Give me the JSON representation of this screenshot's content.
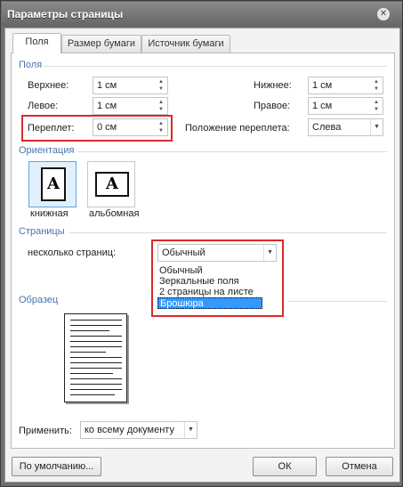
{
  "window": {
    "title": "Параметры страницы"
  },
  "tabs": [
    {
      "label": "Поля"
    },
    {
      "label": "Размер бумаги"
    },
    {
      "label": "Источник бумаги"
    }
  ],
  "margins": {
    "group_title": "Поля",
    "top": {
      "label": "Верхнее:",
      "value": "1 см"
    },
    "left": {
      "label": "Левое:",
      "value": "1 см"
    },
    "gutter": {
      "label": "Переплет:",
      "value": "0 см"
    },
    "bottom": {
      "label": "Нижнее:",
      "value": "1 см"
    },
    "right": {
      "label": "Правое:",
      "value": "1 см"
    },
    "gutter_position": {
      "label": "Положение переплета:",
      "value": "Слева"
    }
  },
  "orientation": {
    "group_title": "Ориентация",
    "portrait": {
      "label": "книжная",
      "glyph": "A"
    },
    "landscape": {
      "label": "альбомная",
      "glyph": "A"
    }
  },
  "pages": {
    "group_title": "Страницы",
    "multiple_label": "несколько страниц:",
    "selected": "Обычный",
    "options": [
      "Обычный",
      "Зеркальные поля",
      "2 страницы на листе",
      "Брошюра"
    ],
    "highlighted_option": "Брошюра"
  },
  "preview": {
    "group_title": "Образец"
  },
  "apply": {
    "label": "Применить:",
    "value": "ко всему документу"
  },
  "buttons": {
    "default": "По умолчанию...",
    "ok": "ОК",
    "cancel": "Отмена"
  },
  "colors": {
    "highlight_box": "#d82a2a",
    "group_title": "#4a74ad",
    "selection": "#3399ff"
  }
}
